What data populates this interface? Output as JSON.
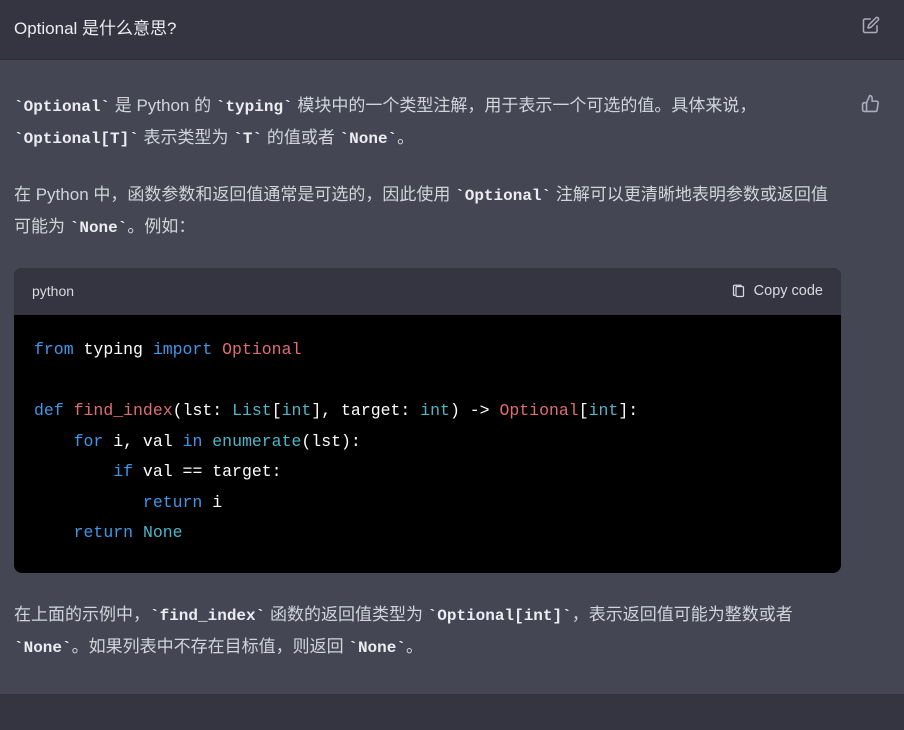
{
  "user": {
    "question": "Optional 是什么意思?"
  },
  "assistant": {
    "para1": {
      "pre1": "",
      "c1": "`Optional`",
      "t1": " 是 Python 的 ",
      "c2": "`typing`",
      "t2": " 模块中的一个类型注解，用于表示一个可选的值。具体来说，",
      "c3": "`Optional[T]`",
      "t3": " 表示类型为 ",
      "c4": "`T`",
      "t4": " 的值或者 ",
      "c5": "`None`",
      "t5": "。"
    },
    "para2": {
      "t1": "在 Python 中，函数参数和返回值通常是可选的，因此使用 ",
      "c1": "`Optional`",
      "t2": " 注解可以更清晰地表明参数或返回值可能为 ",
      "c2": "`None`",
      "t3": "。例如："
    },
    "codeblock": {
      "lang": "python",
      "copy_label": "Copy code",
      "code": {
        "l1_from": "from",
        "l1_mod": " typing ",
        "l1_import": "import",
        "l1_sp": " ",
        "l1_opt": "Optional",
        "l3_def": "def",
        "l3_sp": " ",
        "l3_fn": "find_index",
        "l3_open": "(lst: ",
        "l3_list": "List",
        "l3_br1": "[",
        "l3_int1": "int",
        "l3_br2": "], target: ",
        "l3_int2": "int",
        "l3_arrow": ") -> ",
        "l3_opt": "Optional",
        "l3_br3": "[",
        "l3_int3": "int",
        "l3_br4": "]:",
        "l4_indent": "    ",
        "l4_for": "for",
        "l4_vars": " i, val ",
        "l4_in": "in",
        "l4_sp": " ",
        "l4_enum": "enumerate",
        "l4_arg": "(lst):",
        "l5_indent": "        ",
        "l5_if": "if",
        "l5_cond": " val == target:",
        "l6_indent": "           ",
        "l6_ret": "return",
        "l6_i": " i",
        "l7_indent": "    ",
        "l7_ret": "return",
        "l7_sp": " ",
        "l7_none": "None"
      }
    },
    "para3": {
      "t1": "在上面的示例中，",
      "c1": "`find_index`",
      "t2": " 函数的返回值类型为 ",
      "c2": "`Optional[int]`",
      "t3": "，表示返回值可能为整数或者 ",
      "c3": "`None`",
      "t4": "。如果列表中不存在目标值，则返回 ",
      "c4": "`None`",
      "t5": "。"
    }
  }
}
